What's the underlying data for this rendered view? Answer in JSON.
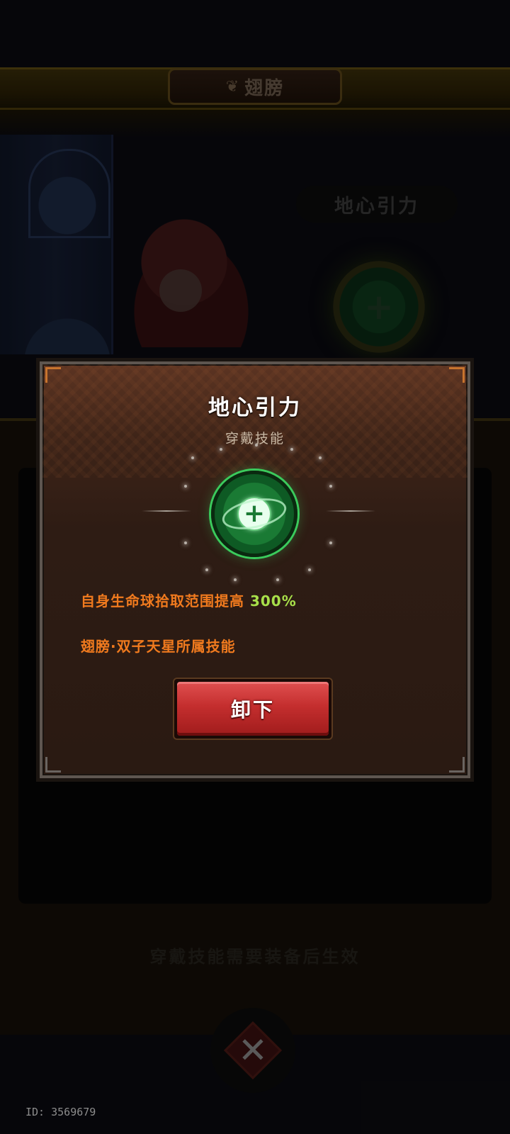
{
  "background": {
    "banner_title": "翅膀",
    "equipped_skill_name": "地心引力",
    "notice": "穿戴技能需要装备后生效",
    "player_id": "ID: 3569679"
  },
  "dialog": {
    "title": "地心引力",
    "subtitle": "穿戴技能",
    "skill_icon": "gravity-plus-orb-icon",
    "description_prefix": "自身生命球拾取范围提高",
    "description_value": "300%",
    "description_source": "翅膀·双子天星所属技能",
    "unequip_label": "卸下"
  },
  "colors": {
    "description_text": "#f07a1e",
    "highlight_value": "#a8e04a",
    "button_red": "#c42e2e",
    "modal_brown": "#2e1c14"
  }
}
